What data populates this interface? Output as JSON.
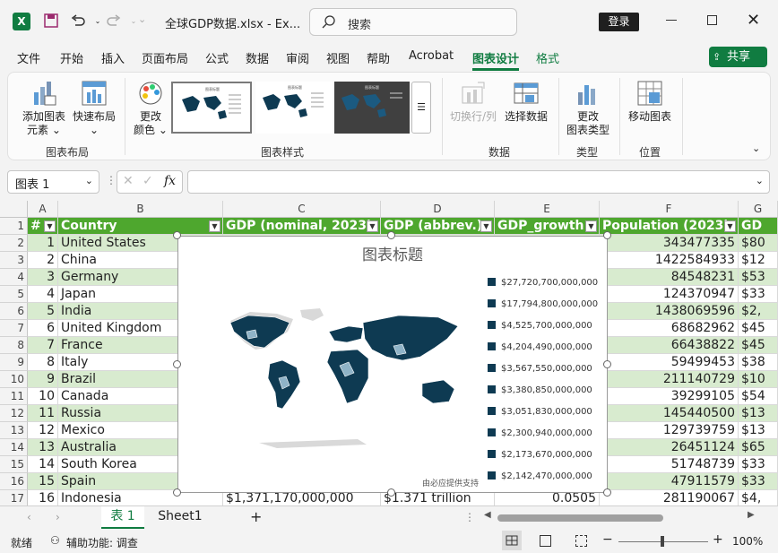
{
  "window": {
    "file_title": "全球GDP数据.xlsx  -  Ex...",
    "search_placeholder": "搜索",
    "login_label": "登录"
  },
  "tabs": [
    "文件",
    "开始",
    "插入",
    "页面布局",
    "公式",
    "数据",
    "审阅",
    "视图",
    "帮助",
    "Acrobat",
    "图表设计",
    "格式"
  ],
  "share_label": "共享",
  "ribbon": {
    "add_element": [
      "添加图表",
      "元素"
    ],
    "quick_layout": "快速布局",
    "change_color": [
      "更改",
      "颜色"
    ],
    "switch_rowcol": "切换行/列",
    "select_data": "选择数据",
    "change_type": [
      "更改",
      "图表类型"
    ],
    "move_chart": "移动图表",
    "groups": [
      "图表布局",
      "图表样式",
      "数据",
      "类型",
      "位置"
    ]
  },
  "formula_bar": {
    "name_box": "图表 1",
    "fx": "fx"
  },
  "columns": [
    "A",
    "B",
    "C",
    "D",
    "E",
    "F",
    "G"
  ],
  "header_row": [
    "#",
    "Country",
    "GDP (nominal, 2023)",
    "GDP (abbrev.)",
    "GDP_growth",
    "Population (2023)",
    "GD"
  ],
  "rows": [
    {
      "n": "1",
      "country": "United States",
      "f": "343477335",
      "g": "$80"
    },
    {
      "n": "2",
      "country": "China",
      "f": "1422584933",
      "g": "$12"
    },
    {
      "n": "3",
      "country": "Germany",
      "f": "84548231",
      "g": "$53"
    },
    {
      "n": "4",
      "country": "Japan",
      "f": "124370947",
      "g": "$33"
    },
    {
      "n": "5",
      "country": "India",
      "f": "1438069596",
      "g": "$2,"
    },
    {
      "n": "6",
      "country": "United Kingdom",
      "f": "68682962",
      "g": "$45"
    },
    {
      "n": "7",
      "country": "France",
      "f": "66438822",
      "g": "$45"
    },
    {
      "n": "8",
      "country": "Italy",
      "f": "59499453",
      "g": "$38"
    },
    {
      "n": "9",
      "country": "Brazil",
      "f": "211140729",
      "g": "$10"
    },
    {
      "n": "10",
      "country": "Canada",
      "f": "39299105",
      "g": "$54"
    },
    {
      "n": "11",
      "country": "Russia",
      "f": "145440500",
      "g": "$13"
    },
    {
      "n": "12",
      "country": "Mexico",
      "f": "129739759",
      "g": "$13"
    },
    {
      "n": "13",
      "country": "Australia",
      "f": "26451124",
      "g": "$65"
    },
    {
      "n": "14",
      "country": "South Korea",
      "f": "51748739",
      "g": "$33"
    },
    {
      "n": "15",
      "country": "Spain",
      "f": "47911579",
      "g": "$33"
    },
    {
      "n": "16",
      "country": "Indonesia",
      "c": "$1,371,170,000,000",
      "d": "$1.371 trillion",
      "e": "0.0505",
      "f": "281190067",
      "g": "$4,"
    }
  ],
  "row_numbers": [
    "1",
    "2",
    "3",
    "4",
    "5",
    "6",
    "7",
    "8",
    "9",
    "10",
    "11",
    "12",
    "13",
    "14",
    "15",
    "16",
    "17"
  ],
  "chart": {
    "title": "图表标题",
    "legend": [
      "$27,720,700,000,000",
      "$17,794,800,000,000",
      "$4,525,700,000,000",
      "$4,204,490,000,000",
      "$3,567,550,000,000",
      "$3,380,850,000,000",
      "$3,051,830,000,000",
      "$2,300,940,000,000",
      "$2,173,670,000,000",
      "$2,142,470,000,000"
    ],
    "credit": "由必应提供支持",
    "fill_color": "#0e3a52",
    "light_color": "#8fb3c7",
    "land_color": "#d9d9d9"
  },
  "sheets": [
    "表 1",
    "Sheet1"
  ],
  "status": {
    "ready": "就绪",
    "accessibility": "辅助功能: 调查",
    "zoom": "100%"
  }
}
